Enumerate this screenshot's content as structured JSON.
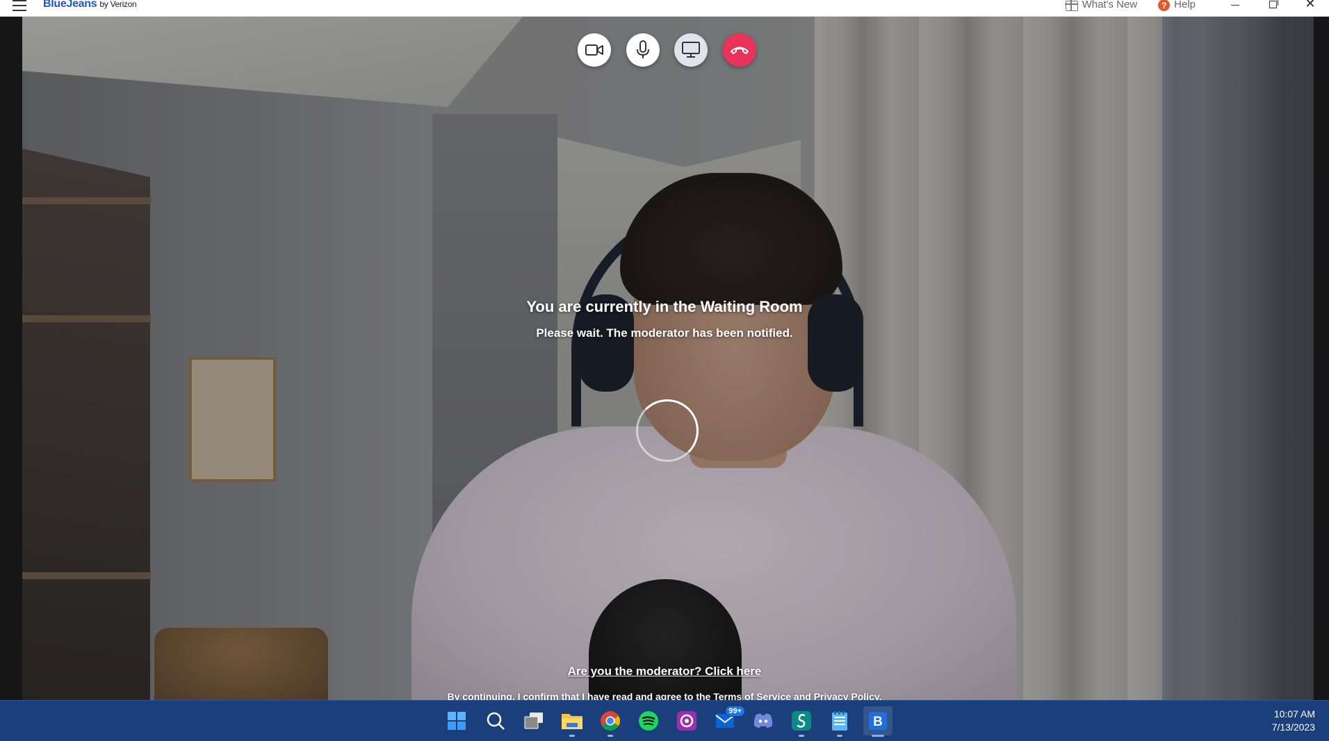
{
  "titlebar": {
    "brand": "BlueJeans",
    "brand_suffix": "by Verizon",
    "whats_new": "What's New",
    "help": "Help",
    "help_glyph": "?",
    "close_glyph": "✕"
  },
  "controls": {
    "video_icon": "video-camera-icon",
    "mic_icon": "microphone-icon",
    "screen_icon": "screen-share-icon",
    "leave_icon": "hang-up-icon",
    "leave_color": "#e8335b"
  },
  "waiting": {
    "title": "You are currently in the Waiting Room",
    "subtitle": "Please wait. The moderator has been notified.",
    "moderator_link": "Are you the moderator? Click here",
    "terms": "By continuing, I confirm that I have read and agree to the Terms of Service and Privacy Policy."
  },
  "taskbar": {
    "apps": [
      "start-icon",
      "search-icon",
      "task-view-icon",
      "file-explorer-icon",
      "chrome-icon",
      "spotify-icon",
      "app-icon",
      "mail-icon",
      "discord-icon",
      "app-s-icon",
      "notepad-icon",
      "bluejeans-icon"
    ],
    "mail_badge": "99+",
    "bluejeans_glyph": "B",
    "time": "10:07 AM",
    "date": "7/13/2023"
  },
  "colors": {
    "brand_blue": "#1a58c4",
    "taskbar_bg": "#1b3f7a",
    "help_orange": "#e2582c"
  }
}
